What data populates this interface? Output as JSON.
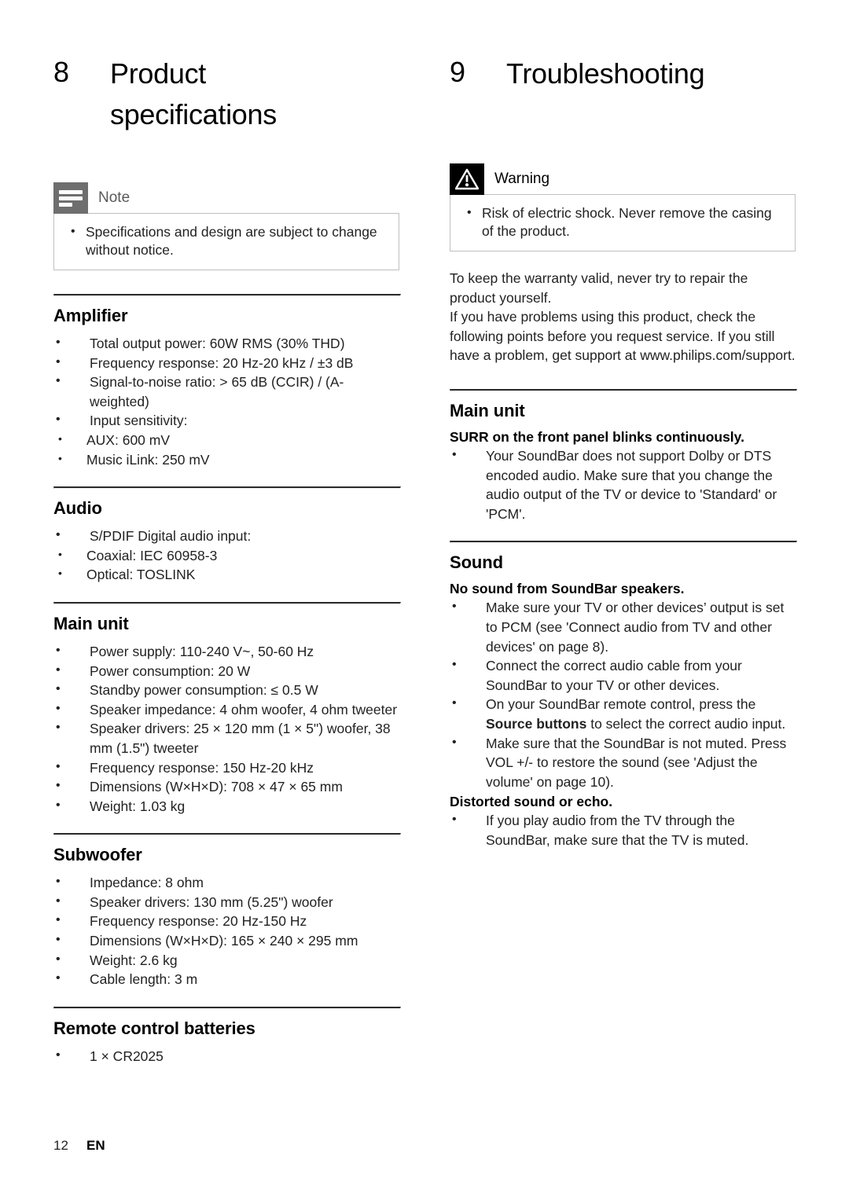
{
  "document": {
    "footer": {
      "page_number": "12",
      "language": "EN"
    }
  },
  "left_column": {
    "chapter": {
      "number": "8",
      "title_line1": "Product",
      "title_line2": "specifications"
    },
    "note_callout": {
      "icon": "note-icon",
      "label": "Note",
      "items": [
        "Specifications and design are subject to change without notice."
      ]
    },
    "sections": [
      {
        "title": "Amplifier",
        "items": [
          "Total output power: 60W RMS (30% THD)",
          "Frequency response: 20 Hz-20 kHz / ±3 dB",
          "Signal-to-noise ratio: > 65 dB (CCIR) / (A-weighted)",
          "Input sensitivity:"
        ],
        "subitems": [
          "AUX: 600 mV",
          "Music iLink: 250 mV"
        ]
      },
      {
        "title": "Audio",
        "items": [
          "S/PDIF Digital audio input:"
        ],
        "subitems": [
          "Coaxial: IEC 60958-3",
          "Optical: TOSLINK"
        ]
      },
      {
        "title": "Main unit",
        "items": [
          "Power supply: 110-240 V~, 50-60 Hz",
          "Power consumption: 20 W",
          "Standby power consumption: ≤ 0.5 W",
          "Speaker impedance: 4 ohm woofer, 4 ohm tweeter",
          "Speaker drivers: 25 × 120 mm (1 × 5\") woofer, 38 mm (1.5\") tweeter",
          "Frequency response: 150 Hz-20 kHz",
          "Dimensions (W×H×D): 708 × 47 × 65 mm",
          "Weight: 1.03 kg"
        ]
      },
      {
        "title": "Subwoofer",
        "items": [
          "Impedance: 8 ohm",
          "Speaker drivers: 130 mm (5.25\") woofer",
          "Frequency response: 20 Hz-150 Hz",
          "Dimensions (W×H×D): 165 × 240 × 295 mm",
          "Weight: 2.6 kg",
          "Cable length: 3 m"
        ]
      },
      {
        "title": "Remote control batteries",
        "items": [
          "1 × CR2025"
        ]
      }
    ]
  },
  "right_column": {
    "chapter": {
      "number": "9",
      "title_line1": "Troubleshooting"
    },
    "warning_callout": {
      "icon": "warning-triangle-icon",
      "label": "Warning",
      "items": [
        "Risk of electric shock. Never remove the casing of the product."
      ]
    },
    "intro_paragraphs": [
      "To keep the warranty valid, never try to repair the product yourself.",
      "If you have problems using this product, check the following points before you request service. If you still have a problem, get support at www.philips.com/support."
    ],
    "sections": [
      {
        "title": "Main unit",
        "problem": "SURR on the front panel blinks continuously.",
        "items": [
          "Your SoundBar does not support Dolby or DTS encoded audio. Make sure that you change the audio output of the TV or device to 'Standard' or 'PCM'."
        ]
      },
      {
        "title": "Sound",
        "problem": "No sound from SoundBar speakers.",
        "items_html": [
          "Make sure your TV or other devices’ output is set to PCM (see 'Connect audio from TV and other devices' on page 8).",
          "Connect the correct audio cable from your SoundBar to your TV or other devices.",
          "On your SoundBar remote control, press the <b>Source buttons</b> to select the correct audio input.",
          "Make sure that the SoundBar is not muted. Press VOL +/- to restore the sound (see 'Adjust the volume' on page 10)."
        ],
        "problem2": "Distorted sound or echo.",
        "items2": [
          "If you play audio from the TV through the SoundBar, make sure that the TV is muted."
        ]
      }
    ]
  }
}
